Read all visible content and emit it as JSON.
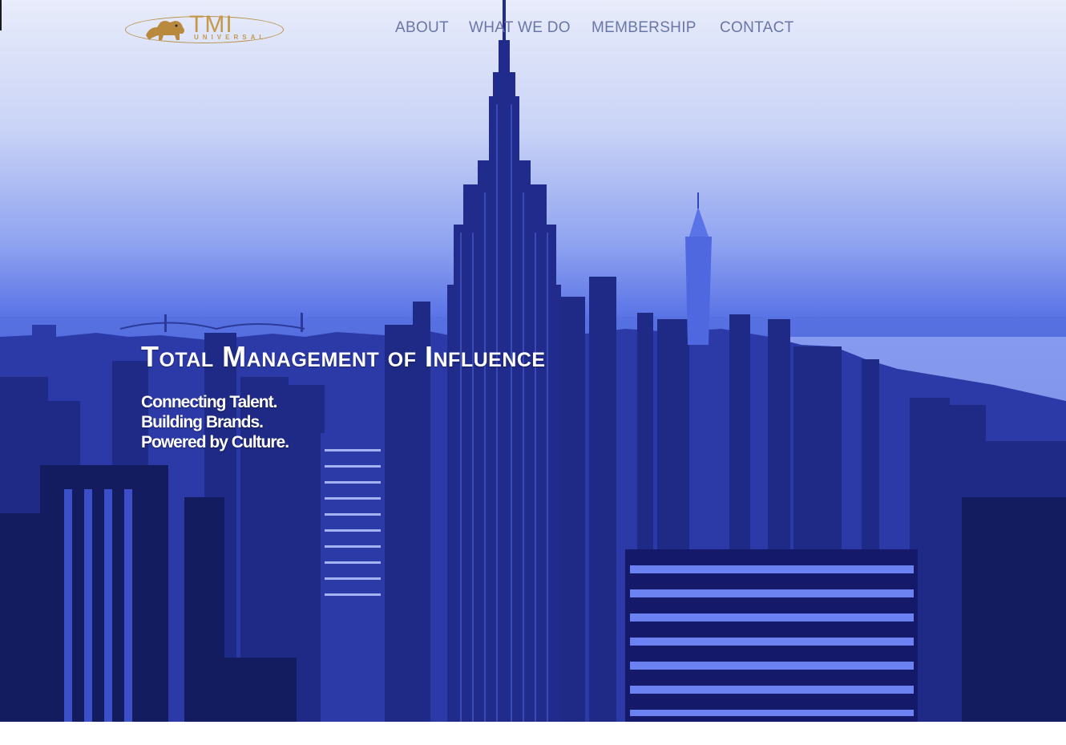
{
  "header": {
    "logo": {
      "wordmark": "TMI",
      "subtext": "UNIVERSAL",
      "icon": "lion-icon",
      "color": "#c49a4a"
    },
    "nav": [
      {
        "label": "ABOUT"
      },
      {
        "label": "WHAT WE DO"
      },
      {
        "label": "MEMBERSHIP"
      },
      {
        "label": "CONTACT"
      }
    ],
    "nav_color": "#6a76a8"
  },
  "hero": {
    "headline": "Total Management of Influence",
    "tagline": [
      "Connecting Talent.",
      "Building Brands.",
      "Powered by Culture."
    ],
    "background": "blue-tinted New York City skyline",
    "tint_color": "#3145b8"
  }
}
